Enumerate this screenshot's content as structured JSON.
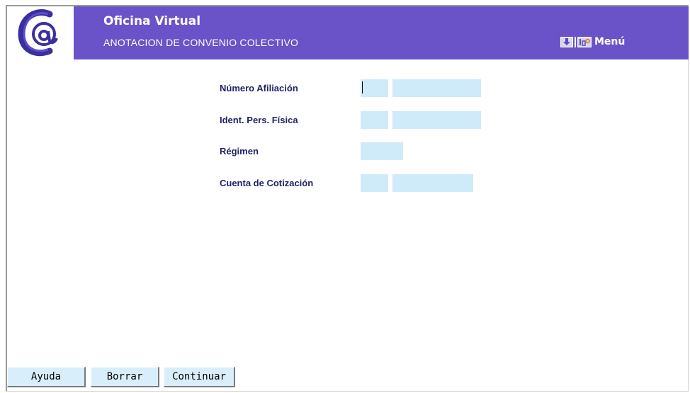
{
  "header": {
    "title": "Oficina Virtual",
    "subtitle": "ANOTACION DE CONVENIO COLECTIVO",
    "menu_label": "Menú"
  },
  "form": {
    "fields": [
      {
        "label": "Número Afiliación",
        "value_1": "",
        "value_2": ""
      },
      {
        "label": "Ident. Pers. Física",
        "value_1": "",
        "value_2": ""
      },
      {
        "label": "Régimen",
        "value_1": ""
      },
      {
        "label": "Cuenta de Cotización",
        "value_1": "",
        "value_2": ""
      }
    ]
  },
  "buttons": {
    "help": "Ayuda",
    "clear": "Borrar",
    "continue": "Continuar"
  },
  "colors": {
    "header_bg": "#6a52c8",
    "field_bg": "#cfeaf8",
    "label_color": "#22226a",
    "button_bg": "#d8eefb"
  }
}
